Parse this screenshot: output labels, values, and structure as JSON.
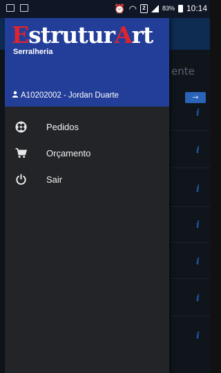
{
  "status_bar": {
    "battery_percent": "83%",
    "time": "10:14",
    "sim_label": "2"
  },
  "app_behind": {
    "label_fragment": "ente",
    "arrow_button": "→",
    "info_marker": "i"
  },
  "drawer": {
    "brand": {
      "first_letter": "E",
      "part1": "strutur",
      "second_letter": "A",
      "part2": "rt",
      "subtitle": "Serralheria"
    },
    "user": "A10202002 - Jordan Duarte",
    "menu": [
      {
        "label": "Pedidos",
        "icon": "clover-icon"
      },
      {
        "label": "Orçamento",
        "icon": "cart-icon"
      },
      {
        "label": "Sair",
        "icon": "power-icon"
      }
    ]
  },
  "colors": {
    "drawer_header": "#233e99",
    "drawer_body": "#222428",
    "brand_accent": "#e2232b",
    "app_header": "#0e2b52"
  }
}
